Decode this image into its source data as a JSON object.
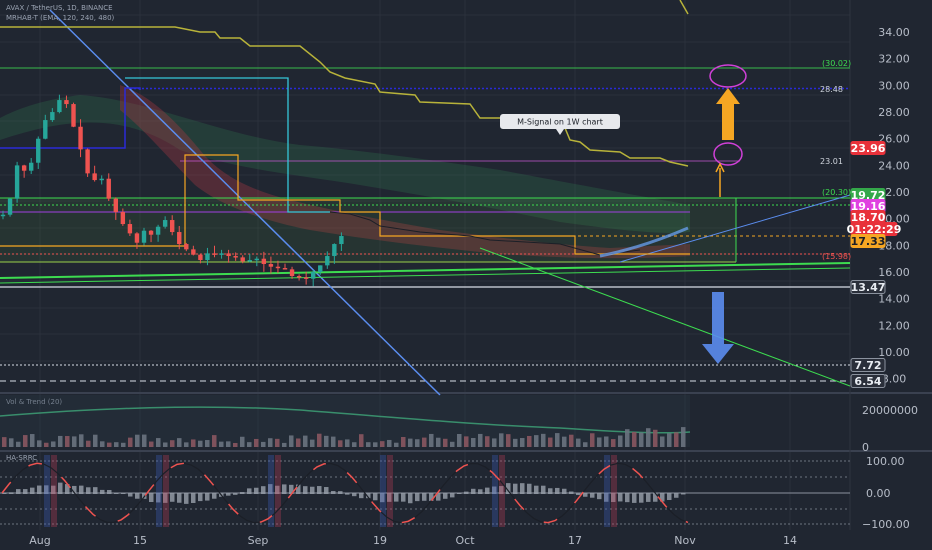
{
  "header": {
    "symbol_line": "AVAX / TetherUS, 1D, BINANCE",
    "indicator_line": "MRHAB-T (EMA, 120, 240, 480)",
    "volume_title": "Vol & Trend (20)",
    "osc_title": "HA-SRRC"
  },
  "annotation": {
    "label": "M-Signal on 1W chart"
  },
  "levels": {
    "l_30_02": "(30.02)",
    "l_28_48": "28.48",
    "l_23_01": "23.01",
    "l_20_30": "(20.30)",
    "l_15_98": "(15.98)"
  },
  "price_tags": [
    {
      "id": "tag-23-96",
      "text": "23.96",
      "value": 23.96,
      "bg": "#e8313a",
      "fg": "#ffffff"
    },
    {
      "id": "tag-19-72",
      "text": "19.72",
      "value": 19.72,
      "bg": "#34a84a",
      "fg": "#ffffff"
    },
    {
      "id": "tag-19-16",
      "text": "19.16",
      "value": 19.16,
      "bg": "#e040e0",
      "fg": "#ffffff"
    },
    {
      "id": "tag-18-70",
      "text": "18.70",
      "value": 18.7,
      "bg": "#e8313a",
      "fg": "#ffffff"
    },
    {
      "id": "tag-countdown",
      "text": "01:22:29",
      "value": 18.0,
      "bg": "#e8313a",
      "fg": "#ffffff"
    },
    {
      "id": "tag-17-33",
      "text": "17.33",
      "value": 17.33,
      "bg": "#f5a623",
      "fg": "#1b1f27"
    },
    {
      "id": "tag-13-47",
      "text": "13.47",
      "value": 13.47,
      "bg": "#2a2f3a",
      "fg": "#e8ecf2"
    },
    {
      "id": "tag-7-72",
      "text": "7.72",
      "value": 7.72,
      "bg": "#2a2f3a",
      "fg": "#e8ecf2"
    },
    {
      "id": "tag-6-54",
      "text": "6.54",
      "value": 6.54,
      "bg": "#2a2f3a",
      "fg": "#e8ecf2"
    }
  ],
  "chart_data": [
    {
      "type": "candlestick",
      "title": "AVAX / TetherUS, 1D, BINANCE",
      "x_labels": [
        "Aug",
        "15",
        "Sep",
        "19",
        "Oct",
        "17",
        "Nov",
        "14"
      ],
      "y_ticks": [
        "34.00",
        "32.00",
        "30.00",
        "28.00",
        "26.00",
        "24.00",
        "22.00",
        "20.00",
        "18.00",
        "16.00",
        "14.00",
        "12.00",
        "10.00",
        "8.00"
      ],
      "ylim": [
        7.3,
        35.0
      ],
      "levels": [
        30.02,
        28.48,
        23.01,
        20.3,
        15.98,
        13.47,
        7.72,
        6.54
      ],
      "close_path": [
        [
          0,
          20.3
        ],
        [
          2,
          21.5
        ],
        [
          5,
          24.0
        ],
        [
          7,
          23.6
        ],
        [
          9,
          24.2
        ],
        [
          12,
          26.0
        ],
        [
          14,
          27.4
        ],
        [
          16,
          28.0
        ],
        [
          18,
          28.9
        ],
        [
          20,
          28.6
        ],
        [
          22,
          26.9
        ],
        [
          24,
          25.2
        ],
        [
          26,
          23.4
        ],
        [
          28,
          22.9
        ],
        [
          30,
          23.0
        ],
        [
          32,
          21.5
        ],
        [
          34,
          20.5
        ],
        [
          36,
          19.6
        ],
        [
          38,
          18.9
        ],
        [
          40,
          18.2
        ],
        [
          42,
          19.1
        ],
        [
          44,
          18.8
        ],
        [
          46,
          19.4
        ],
        [
          48,
          19.9
        ],
        [
          50,
          19.0
        ],
        [
          52,
          18.1
        ],
        [
          54,
          17.7
        ],
        [
          56,
          17.3
        ],
        [
          58,
          16.9
        ],
        [
          60,
          17.4
        ],
        [
          62,
          17.3
        ],
        [
          64,
          17.4
        ],
        [
          66,
          17.2
        ],
        [
          68,
          17.1
        ],
        [
          70,
          16.8
        ],
        [
          72,
          16.9
        ],
        [
          74,
          17.0
        ],
        [
          76,
          16.6
        ],
        [
          78,
          16.4
        ],
        [
          80,
          16.3
        ],
        [
          82,
          16.2
        ],
        [
          84,
          15.7
        ],
        [
          86,
          15.6
        ],
        [
          88,
          15.5
        ],
        [
          90,
          16.0
        ],
        [
          92,
          16.5
        ],
        [
          94,
          17.2
        ],
        [
          96,
          18.1
        ],
        [
          98,
          18.7
        ]
      ]
    },
    {
      "type": "bar",
      "title": "Vol & Trend (20)",
      "y_ticks": [
        "20000000",
        "0"
      ]
    },
    {
      "type": "line",
      "title": "HA-SRRC",
      "y_ticks": [
        "100.00",
        "0.00",
        "−100.00"
      ],
      "ylim": [
        -110,
        110
      ]
    }
  ],
  "colors": {
    "background": "#202631",
    "grid": "#2c3240",
    "tick_text": "#b7bdc8",
    "up": "#26a69a",
    "down": "#ef5350",
    "blue_line": "#5b8def",
    "green_line": "#3ddc50",
    "olive_line": "#b8b33a",
    "cyan_line": "#35c6d8",
    "orange_line": "#f5a623",
    "magenta": "#e040e0",
    "navy": "#2a2ad8",
    "arrow_orange": "#f5a623",
    "arrow_blue": "#5b8def"
  }
}
